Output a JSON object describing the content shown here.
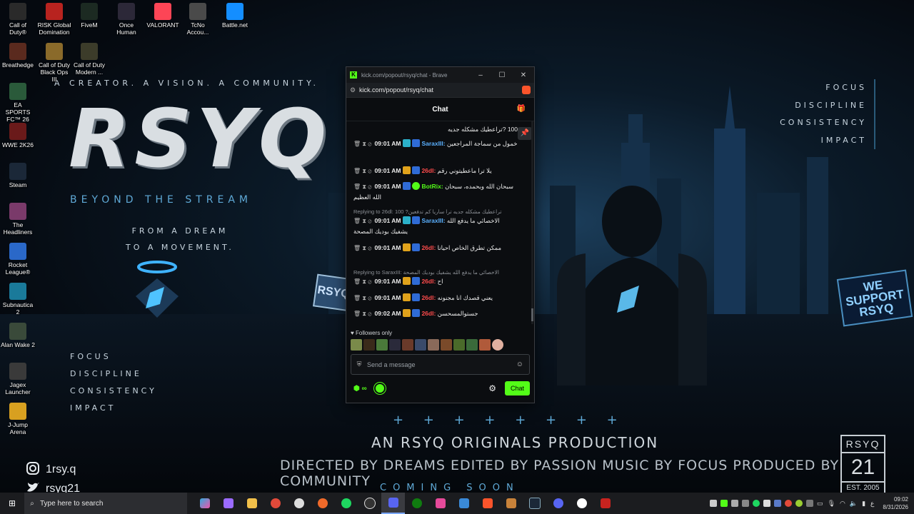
{
  "desktop_icons": [
    {
      "label": "Call of Duty®",
      "color": "#2a2a2a"
    },
    {
      "label": "RISK Global Domination",
      "color": "#b8231f"
    },
    {
      "label": "FiveM",
      "color": "#1c2a22"
    },
    {
      "label": "Once Human",
      "color": "#2c2838"
    },
    {
      "label": "VALORANT",
      "color": "#fd4556"
    },
    {
      "label": "TcNo Accou...",
      "color": "#4a4a4a"
    },
    {
      "label": "Battle.net",
      "color": "#148eff"
    },
    {
      "label": "Breathedge",
      "color": "#5a2a1e"
    },
    {
      "label": "Call of Duty Black Ops III",
      "color": "#8a6a2a"
    },
    {
      "label": "Call of Duty Modern ...",
      "color": "#3c3c2a"
    },
    {
      "label": "EA SPORTS FC™ 26",
      "color": "#2a5a3a"
    },
    {
      "label": "WWE 2K26",
      "color": "#6a1a1a"
    },
    {
      "label": "Steam",
      "color": "#1b2838"
    },
    {
      "label": "The Headliners",
      "color": "#7a3a6a"
    },
    {
      "label": "Rocket League®",
      "color": "#2a68c8"
    },
    {
      "label": "Subnautica 2",
      "color": "#1a7a9a"
    },
    {
      "label": "Alan Wake 2",
      "color": "#3a4a3a"
    },
    {
      "label": "Jagex Launcher",
      "color": "#3a3a3a"
    },
    {
      "label": "J-Jump Arena",
      "color": "#d8a020"
    }
  ],
  "wallpaper": {
    "tagline": "A CREATOR. A VISION. A COMMUNITY.",
    "logo": "RSYQ",
    "subtitle": "BEYOND THE STREAM",
    "dream_line1": "FROM A DREAM",
    "dream_line2": "TO A MOVEMENT.",
    "values": [
      "FOCUS",
      "DISCIPLINE",
      "CONSISTENCY",
      "IMPACT"
    ],
    "plus_row": "+ + + + + + + +",
    "originals": "AN RSYQ ORIGINALS PRODUCTION",
    "credits": "DIRECTED BY DREAMS  EDITED BY PASSION  MUSIC BY FOCUS  PRODUCED BY COMMUNITY",
    "coming_soon": "COMING SOON",
    "badge_top": "RSYQ",
    "badge_num": "21",
    "badge_est": "EST. 2005",
    "sign_left": "RSYQ",
    "we_support": "WE SUPPORT RSYQ",
    "instagram": "1rsy.q",
    "twitter": "rsyq21"
  },
  "popup": {
    "window_title": "kick.com/popout/rsyq/chat - Brave",
    "url": "kick.com/popout/rsyq/chat",
    "chat_title": "Chat",
    "pinned_top": "100 ?تراعطيك مشكله جديه",
    "messages": [
      {
        "time": "09:01 AM",
        "user": "SaraxIII:",
        "user_color": "#5ab0ff",
        "text": "خمول من سماجة المراجعين"
      },
      {
        "time": "09:01 AM",
        "user": "26dl:",
        "user_color": "#ff4b4b",
        "text": "يلا ترا ماعطيتوني رقم"
      },
      {
        "time": "09:01 AM",
        "user": "BotRix:",
        "user_color": "#53fc18",
        "text": "سبحان الله وبحمده، سبحان الله العظيم"
      },
      {
        "time": "09:01 AM",
        "user": "SaraxIII:",
        "user_color": "#5ab0ff",
        "text": "الاخصائي ما يدفع الله يشفيك بوديك المصحة"
      },
      {
        "time": "09:01 AM",
        "user": "26dl:",
        "user_color": "#ff4b4b",
        "text": "ممكن تطرق الخاص احيانا"
      },
      {
        "time": "09:01 AM",
        "user": "26dl:",
        "user_color": "#ff4b4b",
        "text": "اح"
      },
      {
        "time": "09:01 AM",
        "user": "26dl:",
        "user_color": "#ff4b4b",
        "text": "يعني قصدك انا مجنونه"
      },
      {
        "time": "09:02 AM",
        "user": "26dl:",
        "user_color": "#ff4b4b",
        "text": "جستوالمسحسن"
      }
    ],
    "reply1": "Replying to 26dl: 100 ?تراعطيك مشكله جديه ترا ساريا كم تدفعين",
    "reply2": "Replying to SaraxIII: الاخصائي ما يدفع الله يشفيك بوديك المصحة",
    "followers_only": "Followers only",
    "input_placeholder": "Send a message",
    "points": "∞",
    "chat_button": "Chat"
  },
  "taskbar": {
    "search_placeholder": "Type here to search",
    "time": "09:02",
    "date": "8/31/2026",
    "lang": "ع"
  }
}
